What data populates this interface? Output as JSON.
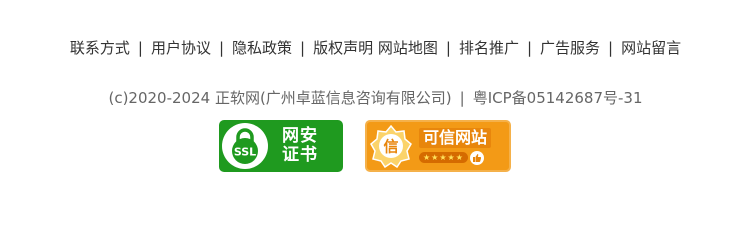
{
  "footer": {
    "links": [
      "联系方式",
      "用户协议",
      "隐私政策",
      "版权声明 网站地图",
      "排名推广",
      "广告服务",
      "网站留言"
    ],
    "separator": "|"
  },
  "copyright": {
    "text": "(c)2020-2024 正软网(广州卓蓝信息咨询有限公司)",
    "separator": "|",
    "icp": "粤ICP备05142687号-31"
  },
  "badges": {
    "ssl": {
      "emblem_text": "SSL",
      "line1": "网安",
      "line2": "证书",
      "color": "#1f9a1f"
    },
    "trust": {
      "emblem_text": "信",
      "title": "可信网站",
      "stars": "★★★★★",
      "color": "#f39a16"
    }
  }
}
